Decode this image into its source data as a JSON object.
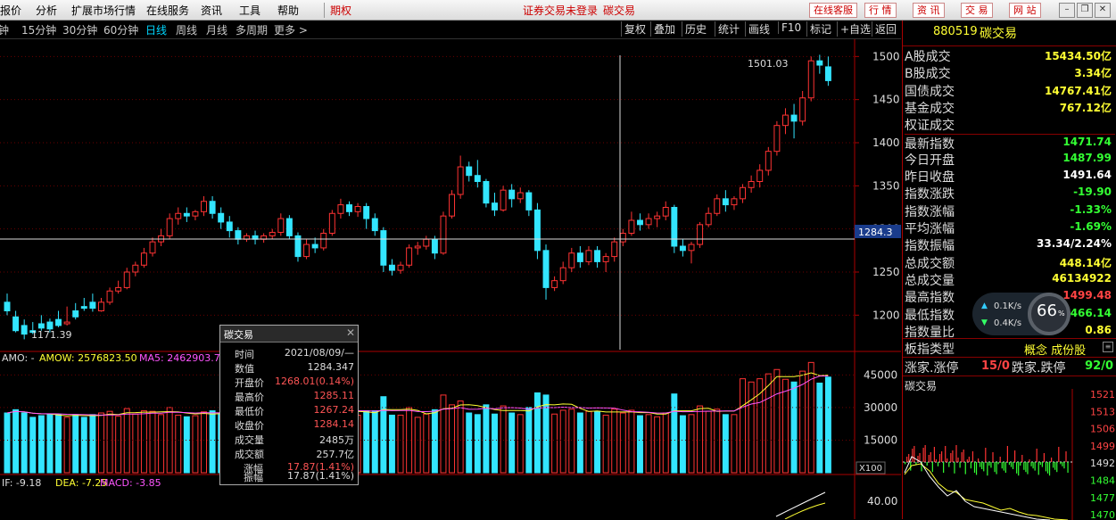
{
  "menu": {
    "items": [
      "报价",
      "分析",
      "扩展市场行情",
      "在线服务",
      "资讯",
      "工具",
      "帮助"
    ],
    "futures": "期权",
    "login_status": "证券交易未登录",
    "current_name": "碳交易",
    "buttons": [
      "在线客服",
      "行 情",
      "资 讯",
      "交 易",
      "网 站"
    ]
  },
  "periods": {
    "items": [
      "钟",
      "15分钟",
      "30分钟",
      "60分钟",
      "日线",
      "周线",
      "月线",
      "多周期",
      "更多 >"
    ],
    "active": "日线"
  },
  "toolbar": [
    "复权",
    "叠加",
    "历史",
    "统计",
    "画线",
    "F10",
    "标记",
    "+自选",
    "返回"
  ],
  "quote": {
    "code": "880519",
    "name": "碳交易",
    "rows": [
      {
        "label": "A股成交",
        "value": "15434.50亿",
        "color": "yellow"
      },
      {
        "label": "B股成交",
        "value": "3.34亿",
        "color": "yellow"
      },
      {
        "label": "国债成交",
        "value": "14767.41亿",
        "color": "yellow"
      },
      {
        "label": "基金成交",
        "value": "767.12亿",
        "color": "yellow"
      },
      {
        "label": "权证成交",
        "value": "",
        "color": "yellow"
      },
      {
        "label": "最新指数",
        "value": "1471.74",
        "color": "green"
      },
      {
        "label": "今日开盘",
        "value": "1487.99",
        "color": "green"
      },
      {
        "label": "昨日收盘",
        "value": "1491.64",
        "color": "white"
      },
      {
        "label": "指数涨跌",
        "value": "-19.90",
        "color": "green"
      },
      {
        "label": "指数涨幅",
        "value": "-1.33%",
        "color": "green"
      },
      {
        "label": "平均涨幅",
        "value": "-1.69%",
        "color": "green"
      },
      {
        "label": "指数振幅",
        "value": "33.34/2.24%",
        "color": "white"
      },
      {
        "label": "总成交额",
        "value": "448.14亿",
        "color": "yellow"
      },
      {
        "label": "总成交量",
        "value": "46134922",
        "color": "yellow"
      },
      {
        "label": "最高指数",
        "value": "1499.48",
        "color": "redc"
      },
      {
        "label": "最低指数",
        "value": "1466.14",
        "color": "green"
      },
      {
        "label": "指数量比",
        "value": "0.86",
        "color": "yellow"
      }
    ],
    "board_type_label": "板指类型",
    "board_type_value": "概念 成份股",
    "up_limit_label": "涨家.涨停",
    "up_limit_value": "15/0",
    "down_limit_label": "跌家.跌停",
    "down_limit_value": "92/0",
    "mini_title": "碳交易",
    "mini_axis": [
      "1521",
      "1513",
      "1506",
      "1499",
      "1492",
      "1484",
      "1477",
      "1470"
    ]
  },
  "network": {
    "up": "0.1K/s",
    "down": "0.4K/s",
    "percent": "66",
    "unit": "%"
  },
  "tooltip": {
    "title": "碳交易",
    "rows": [
      {
        "label": "时间",
        "value": "2021/08/09/—"
      },
      {
        "label": "数值",
        "value": "1284.347"
      },
      {
        "label": "开盘价",
        "value": "1268.01(0.14%)"
      },
      {
        "label": "最高价",
        "value": "1285.11"
      },
      {
        "label": "最低价",
        "value": "1267.24"
      },
      {
        "label": "收盘价",
        "value": "1284.14"
      },
      {
        "label": "成交量",
        "value": "2485万"
      },
      {
        "label": "成交额",
        "value": "257.7亿"
      },
      {
        "label": "涨幅",
        "value": "17.87(1.41%)"
      },
      {
        "label": "振幅",
        "value": "17.87(1.41%)"
      }
    ]
  },
  "chart_data": [
    {
      "type": "candlestick",
      "y_axis_ticks": [
        "1500",
        "1450",
        "1400",
        "1350",
        "1300",
        "1250",
        "1200"
      ],
      "ylim": [
        1160,
        1520
      ],
      "crosshair_value": "1284.3",
      "annotations": [
        "1501.03",
        "1171.39"
      ],
      "candles": [
        [
          1215,
          1225,
          1205,
          1200
        ],
        [
          1198,
          1205,
          1182,
          1180
        ],
        [
          1188,
          1195,
          1178,
          1172
        ],
        [
          1182,
          1192,
          1180,
          1178
        ],
        [
          1190,
          1200,
          1185,
          1182
        ],
        [
          1192,
          1196,
          1184,
          1180
        ],
        [
          1195,
          1205,
          1188,
          1186
        ],
        [
          1190,
          1210,
          1192,
          1188
        ],
        [
          1205,
          1214,
          1198,
          1195
        ],
        [
          1210,
          1220,
          1208,
          1205
        ],
        [
          1215,
          1225,
          1208,
          1204
        ],
        [
          1205,
          1220,
          1215,
          1204
        ],
        [
          1215,
          1232,
          1228,
          1212
        ],
        [
          1228,
          1240,
          1232,
          1225
        ],
        [
          1232,
          1255,
          1250,
          1230
        ],
        [
          1250,
          1262,
          1258,
          1245
        ],
        [
          1258,
          1278,
          1272,
          1255
        ],
        [
          1272,
          1290,
          1285,
          1268
        ],
        [
          1285,
          1300,
          1292,
          1280
        ],
        [
          1292,
          1318,
          1312,
          1288
        ],
        [
          1312,
          1325,
          1318,
          1305
        ],
        [
          1318,
          1325,
          1315,
          1308
        ],
        [
          1315,
          1322,
          1320,
          1310
        ],
        [
          1320,
          1338,
          1332,
          1315
        ],
        [
          1332,
          1338,
          1318,
          1312
        ],
        [
          1318,
          1325,
          1308,
          1300
        ],
        [
          1308,
          1315,
          1298,
          1290
        ],
        [
          1298,
          1302,
          1288,
          1282
        ],
        [
          1288,
          1295,
          1292,
          1285
        ],
        [
          1292,
          1298,
          1288,
          1282
        ],
        [
          1288,
          1295,
          1292,
          1284
        ],
        [
          1292,
          1300,
          1296,
          1288
        ],
        [
          1296,
          1318,
          1312,
          1292
        ],
        [
          1312,
          1316,
          1292,
          1288
        ],
        [
          1292,
          1296,
          1268,
          1262
        ],
        [
          1268,
          1288,
          1282,
          1265
        ],
        [
          1282,
          1290,
          1278,
          1272
        ],
        [
          1278,
          1300,
          1295,
          1275
        ],
        [
          1295,
          1322,
          1318,
          1292
        ],
        [
          1318,
          1335,
          1328,
          1312
        ],
        [
          1328,
          1332,
          1320,
          1315
        ],
        [
          1320,
          1330,
          1326,
          1314
        ],
        [
          1326,
          1330,
          1312,
          1300
        ],
        [
          1312,
          1318,
          1298,
          1292
        ],
        [
          1298,
          1302,
          1258,
          1250
        ],
        [
          1258,
          1265,
          1252,
          1246
        ],
        [
          1252,
          1262,
          1258,
          1248
        ],
        [
          1258,
          1282,
          1278,
          1255
        ],
        [
          1278,
          1285,
          1280,
          1270
        ],
        [
          1280,
          1292,
          1288,
          1276
        ],
        [
          1288,
          1292,
          1272,
          1265
        ],
        [
          1272,
          1320,
          1315,
          1270
        ],
        [
          1315,
          1345,
          1340,
          1312
        ],
        [
          1340,
          1385,
          1372,
          1335
        ],
        [
          1372,
          1378,
          1362,
          1355
        ],
        [
          1362,
          1380,
          1355,
          1348
        ],
        [
          1355,
          1358,
          1330,
          1325
        ],
        [
          1330,
          1342,
          1322,
          1315
        ],
        [
          1322,
          1350,
          1345,
          1320
        ],
        [
          1345,
          1352,
          1335,
          1325
        ],
        [
          1335,
          1348,
          1342,
          1330
        ],
        [
          1342,
          1345,
          1322,
          1315
        ],
        [
          1322,
          1330,
          1275,
          1265
        ],
        [
          1275,
          1282,
          1232,
          1218
        ],
        [
          1232,
          1245,
          1240,
          1228
        ],
        [
          1240,
          1262,
          1255,
          1236
        ],
        [
          1255,
          1278,
          1272,
          1250
        ],
        [
          1272,
          1280,
          1262,
          1255
        ],
        [
          1262,
          1280,
          1275,
          1258
        ],
        [
          1275,
          1280,
          1262,
          1255
        ],
        [
          1262,
          1272,
          1268,
          1250
        ],
        [
          1268,
          1290,
          1285,
          1262
        ],
        [
          1285,
          1300,
          1295,
          1280
        ],
        [
          1295,
          1320,
          1310,
          1292
        ],
        [
          1310,
          1318,
          1305,
          1298
        ],
        [
          1305,
          1318,
          1312,
          1300
        ],
        [
          1312,
          1320,
          1315,
          1302
        ],
        [
          1315,
          1332,
          1325,
          1310
        ],
        [
          1325,
          1328,
          1280,
          1272
        ],
        [
          1280,
          1288,
          1275,
          1268
        ],
        [
          1275,
          1285,
          1282,
          1260
        ],
        [
          1282,
          1308,
          1305,
          1278
        ],
        [
          1305,
          1325,
          1318,
          1302
        ],
        [
          1318,
          1340,
          1335,
          1315
        ],
        [
          1335,
          1345,
          1328,
          1320
        ],
        [
          1328,
          1338,
          1335,
          1322
        ],
        [
          1335,
          1352,
          1348,
          1330
        ],
        [
          1348,
          1362,
          1355,
          1342
        ],
        [
          1355,
          1375,
          1368,
          1348
        ],
        [
          1368,
          1395,
          1390,
          1362
        ],
        [
          1390,
          1425,
          1420,
          1385
        ],
        [
          1420,
          1440,
          1432,
          1410
        ],
        [
          1432,
          1445,
          1425,
          1405
        ],
        [
          1425,
          1460,
          1452,
          1420
        ],
        [
          1452,
          1500,
          1495,
          1448
        ],
        [
          1495,
          1502,
          1490,
          1480
        ],
        [
          1488,
          1500,
          1472,
          1466
        ]
      ]
    },
    {
      "type": "bar",
      "title": "AMO: -",
      "legend": [
        "AMOW: 2576823.50",
        "MA5: 2462903.7"
      ],
      "y_axis_ticks": [
        "45000",
        "30000",
        "15000"
      ],
      "scale_label": "X100",
      "ylim": [
        0,
        55000
      ]
    },
    {
      "type": "line",
      "legend": [
        "IF: -9.18",
        "DEA: -7.25",
        "MACD: -3.85"
      ],
      "y_axis_ticks": [
        "40.00"
      ]
    }
  ]
}
